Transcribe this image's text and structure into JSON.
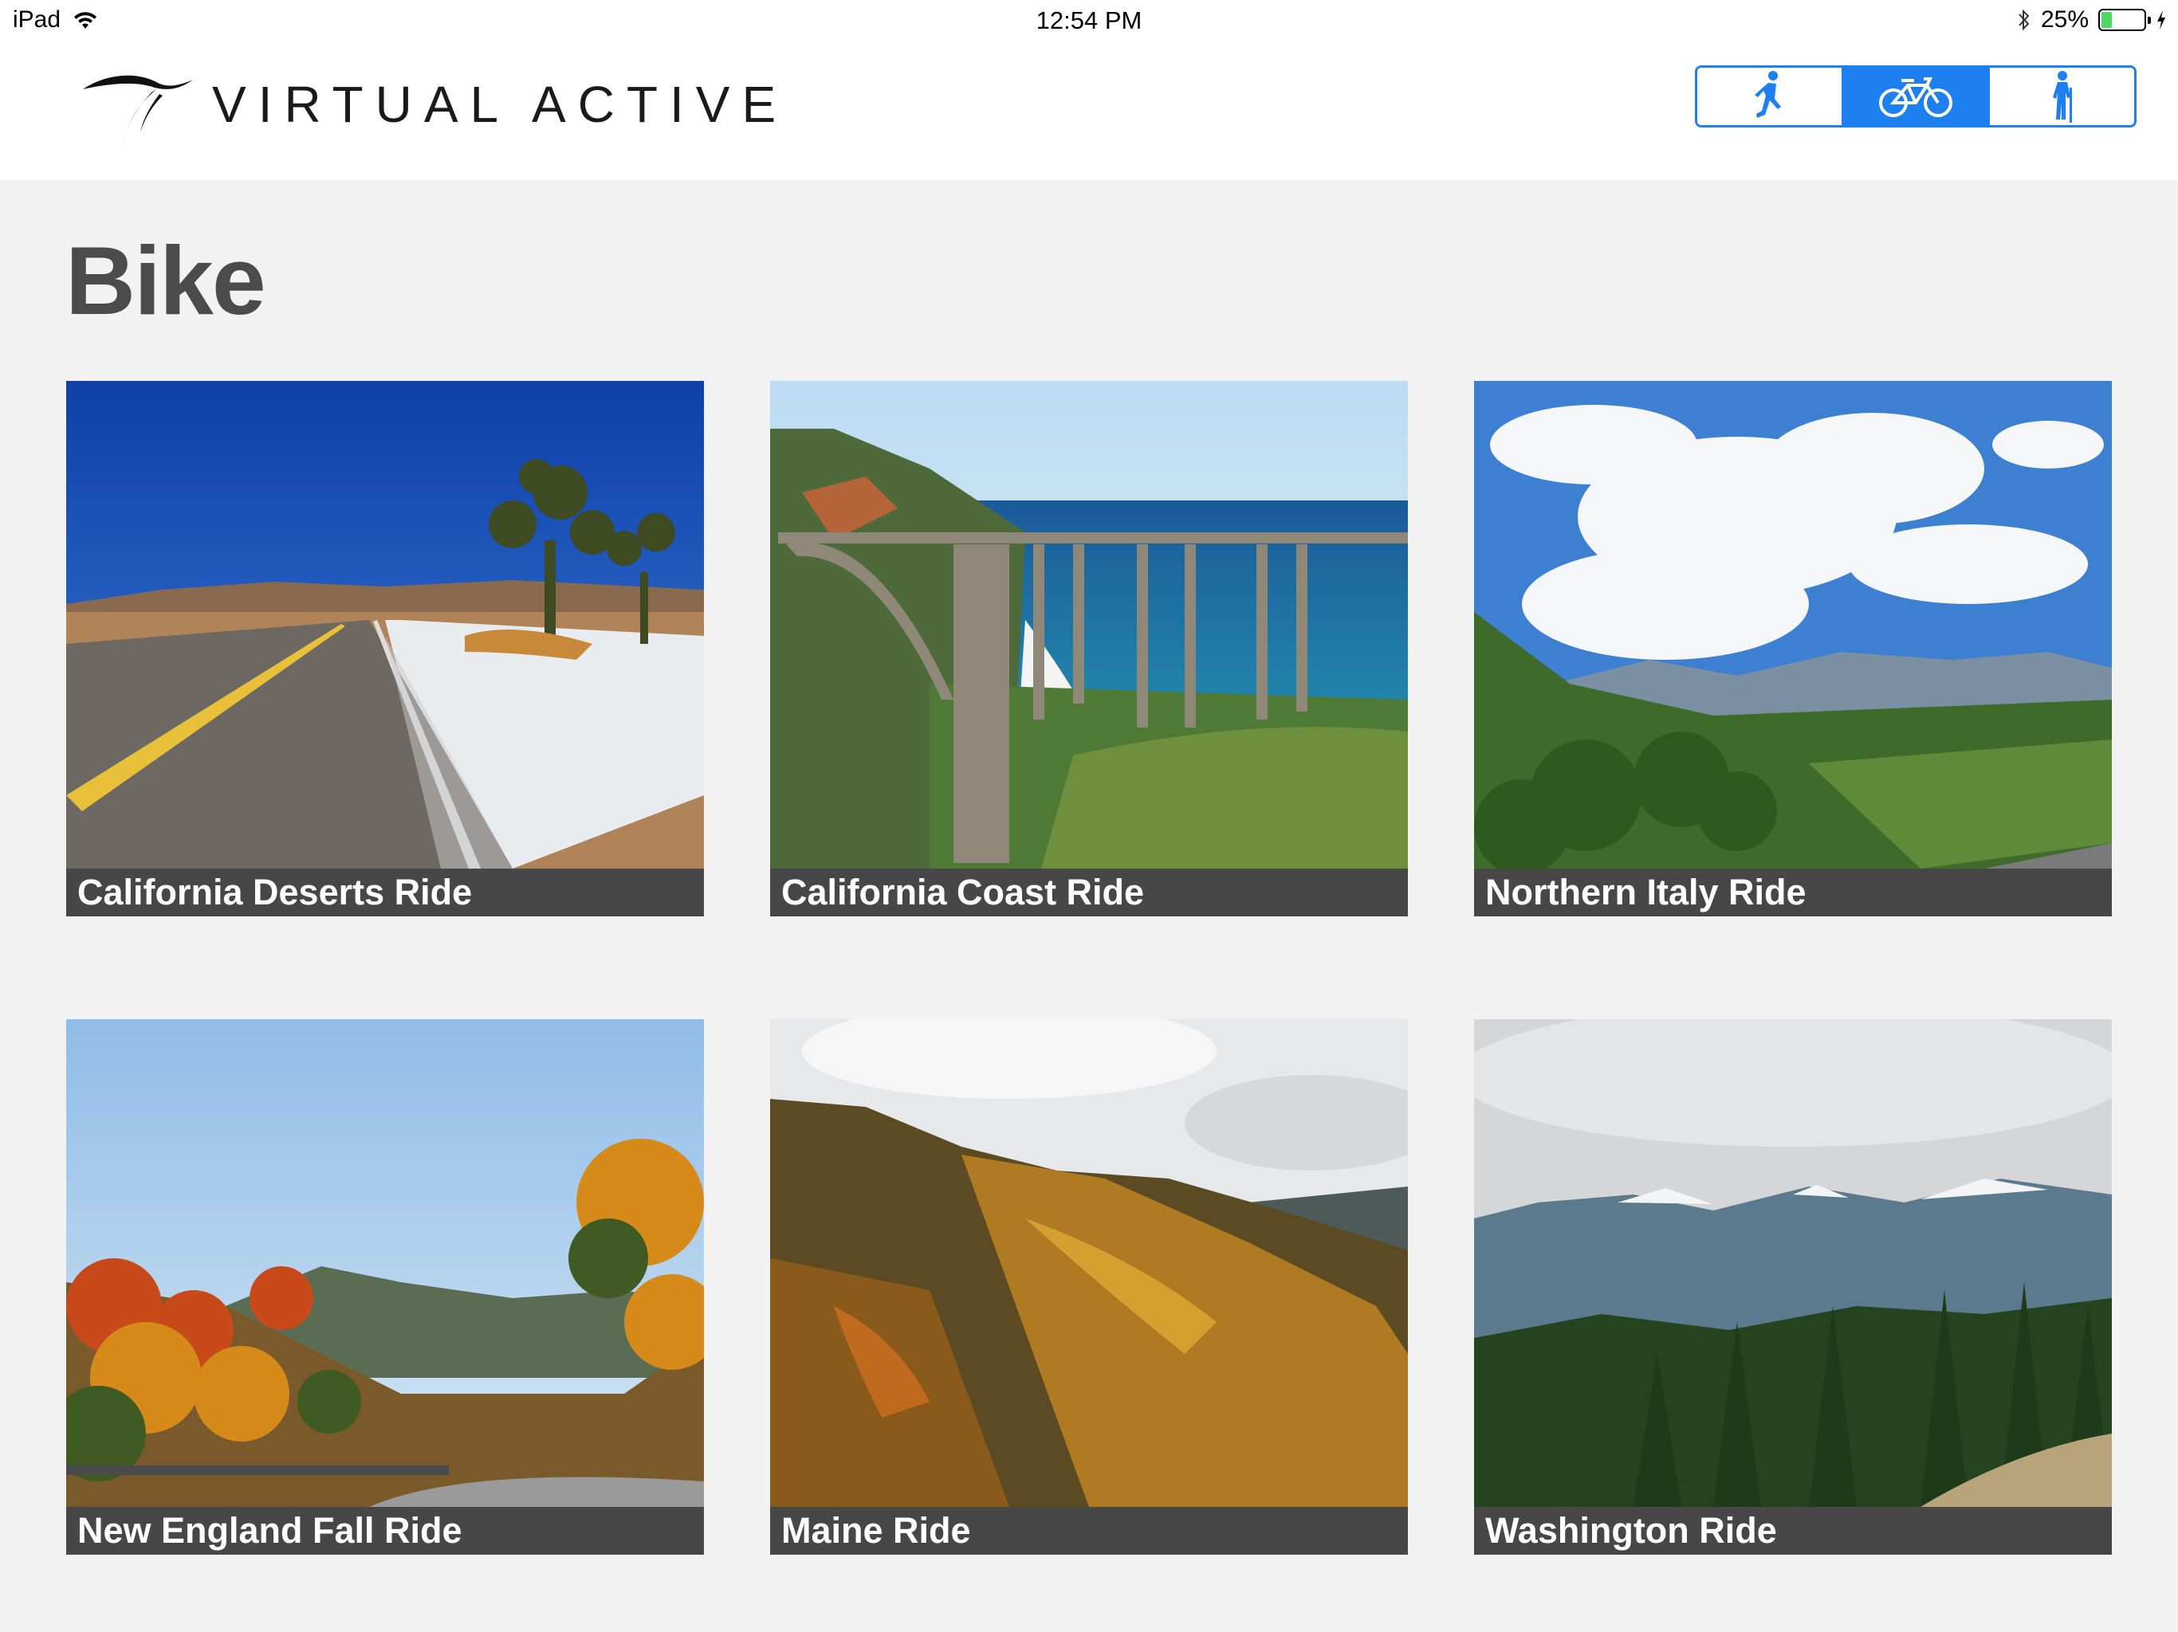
{
  "status_bar": {
    "device": "iPad",
    "time": "12:54 PM",
    "battery_percent": "25%",
    "battery_level": 0.25,
    "icons": [
      "wifi-icon",
      "bluetooth-icon",
      "battery-icon",
      "charging-bolt-icon"
    ]
  },
  "header": {
    "brand": "VIRTUAL ACTIVE",
    "logo_icon": "swoosh-logo-icon",
    "modes": [
      {
        "icon": "runner-icon",
        "active": false
      },
      {
        "icon": "bicycle-icon",
        "active": true
      },
      {
        "icon": "hiker-icon",
        "active": false
      }
    ]
  },
  "page": {
    "title": "Bike"
  },
  "rides": [
    {
      "title": "California Deserts Ride"
    },
    {
      "title": "California Coast Ride"
    },
    {
      "title": "Northern Italy Ride"
    },
    {
      "title": "New England Fall Ride"
    },
    {
      "title": "Maine Ride"
    },
    {
      "title": "Washington Ride"
    }
  ],
  "colors": {
    "accent": "#1e7ff0",
    "background": "#f2f2f2",
    "caption_bar": "#474747",
    "title_text": "#4b4b4b",
    "battery": "#4cd964"
  }
}
